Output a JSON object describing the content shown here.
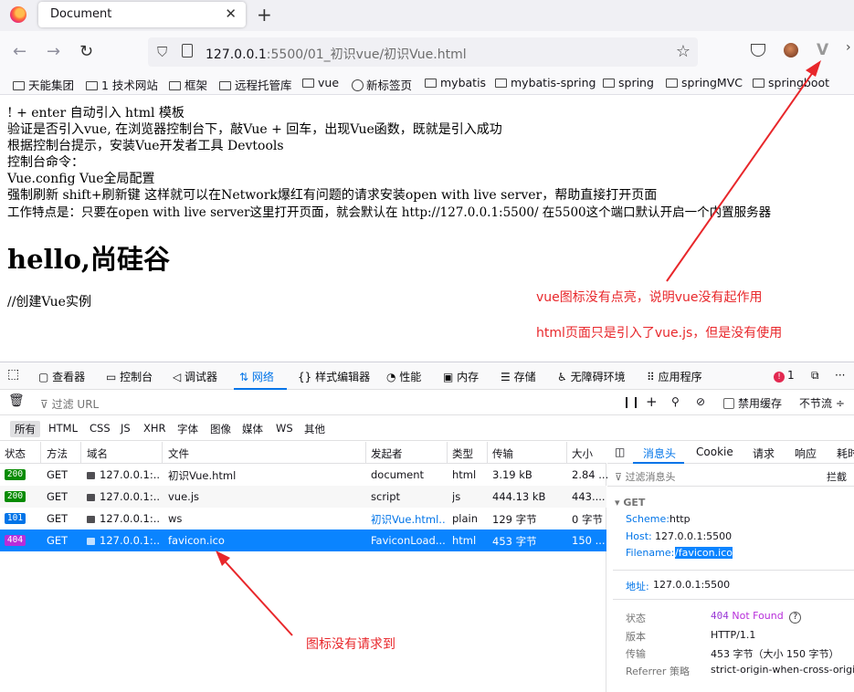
{
  "browser": {
    "tab_title": "Document",
    "url_host": "127.0.0.1",
    "url_rest": ":5500/01_初识vue/初识Vue.html"
  },
  "bookmarks": [
    {
      "label": "天能集团",
      "icon": "folder"
    },
    {
      "label": "1 技术网站",
      "icon": "folder"
    },
    {
      "label": "框架",
      "icon": "folder"
    },
    {
      "label": "远程托管库",
      "icon": "folder"
    },
    {
      "label": "vue",
      "icon": "folder"
    },
    {
      "label": "新标签页",
      "icon": "globe"
    },
    {
      "label": "mybatis",
      "icon": "folder"
    },
    {
      "label": "mybatis-spring",
      "icon": "folder"
    },
    {
      "label": "spring",
      "icon": "folder"
    },
    {
      "label": "springMVC",
      "icon": "folder"
    },
    {
      "label": "springboot",
      "icon": "folder"
    }
  ],
  "page": {
    "lines": [
      "! + enter 自动引入 html 模板",
      "验证是否引入vue, 在浏览器控制台下，敲Vue + 回车，出现Vue函数，既就是引入成功",
      "根据控制台提示，安装Vue开发者工具 Devtools",
      "控制台命令：",
      "Vue.config Vue全局配置",
      "强制刷新 shift+刷新键 这样就可以在Network爆红有问题的请求安装open with live server，帮助直接打开页面",
      "工作特点是：只要在open with live server这里打开页面，就会默认在 http://127.0.0.1:5500/ 在5500这个端口默认开启一个内置服务器"
    ],
    "heading": "hello,尚硅谷",
    "comment": "//创建Vue实例"
  },
  "annotations": {
    "vue_icon": "vue图标没有点亮，说明vue没有起作用",
    "html_note": "html页面只是引入了vue.js，但是没有使用",
    "favicon": "图标没有请求到"
  },
  "devtools": {
    "tabs": [
      "查看器",
      "控制台",
      "调试器",
      "网络",
      "样式编辑器",
      "性能",
      "内存",
      "存储",
      "无障碍环境",
      "应用程序"
    ],
    "active_tab": "网络",
    "error_count": "1",
    "filter_placeholder": "过滤 URL",
    "disable_cache": "禁用缓存",
    "throttle": "不节流 ÷",
    "types": [
      "所有",
      "HTML",
      "CSS",
      "JS",
      "XHR",
      "字体",
      "图像",
      "媒体",
      "WS",
      "其他"
    ],
    "columns": [
      "状态",
      "方法",
      "域名",
      "文件",
      "发起者",
      "类型",
      "传输",
      "大小"
    ],
    "rows": [
      {
        "status": "200",
        "method": "GET",
        "domain": "127.0.0.1:...",
        "file": "初识Vue.html",
        "initiator": "document",
        "type": "html",
        "transfer": "3.19 kB",
        "size": "2.84 ..."
      },
      {
        "status": "200",
        "method": "GET",
        "domain": "127.0.0.1:...",
        "file": "vue.js",
        "initiator": "script",
        "type": "js",
        "transfer": "444.13 kB",
        "size": "443...."
      },
      {
        "status": "101",
        "method": "GET",
        "domain": "127.0.0.1:...",
        "file": "ws",
        "initiator": "初识Vue.html...",
        "type": "plain",
        "transfer": "129 字节",
        "size": "0 字节"
      },
      {
        "status": "404",
        "method": "GET",
        "domain": "127.0.0.1:...",
        "file": "favicon.ico",
        "initiator": "FaviconLoad...",
        "type": "html",
        "transfer": "453 字节",
        "size": "150 ..."
      }
    ],
    "status_colors": {
      "200": "#058b00",
      "101": "#0074e8",
      "404": "#b72dda"
    },
    "details": {
      "tabs": [
        "消息头",
        "Cookie",
        "请求",
        "响应",
        "耗时"
      ],
      "filter": "过滤消息头",
      "block": "拦截",
      "get": "GET",
      "scheme_k": "Scheme:",
      "scheme_v": "http",
      "host_k": "Host:",
      "host_v": "127.0.0.1:5500",
      "filename_k": "Filename:",
      "filename_v": "/favicon.ico",
      "address_k": "地址:",
      "address_v": "127.0.0.1:5500",
      "status_k": "状态",
      "status_code": "404",
      "status_text": "Not Found",
      "version_k": "版本",
      "version_v": "HTTP/1.1",
      "transfer_k": "传输",
      "transfer_v": "453 字节（大小 150 字节）",
      "referrer_k": "Referrer 策略",
      "referrer_v": "strict-origin-when-cross-origin"
    }
  }
}
